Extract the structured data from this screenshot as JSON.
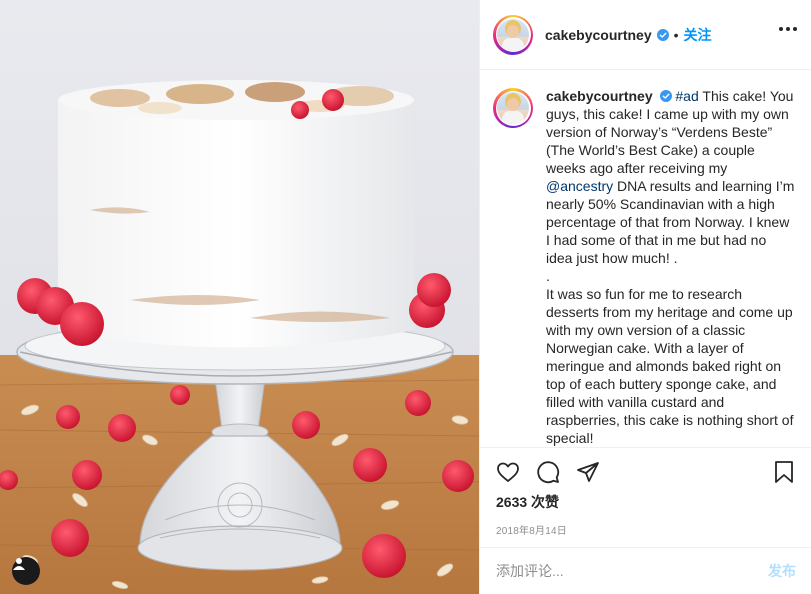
{
  "photo": {
    "subject": "cake-photo",
    "user_tag_icon": "user-icon"
  },
  "header": {
    "username": "cakebycourtney",
    "verified_icon": "verified-badge-icon",
    "separator": "•",
    "follow_label": "关注",
    "more_icon": "more-options-icon"
  },
  "caption": {
    "username": "cakebycourtney",
    "hashtag": "#ad",
    "text_1": " This cake! You guys, this cake! I came up with my own version of Norway’s “Verdens Beste” (The World’s Best Cake) a couple weeks ago after receiving my ",
    "mention": "@ancestry",
    "text_2": " DNA results and learning I’m nearly 50% Scandinavian with a high percentage of that from Norway. I knew I had some of that in me but had no idea just how much! .",
    "dot_line": ".",
    "paragraph_2": "It was so fun for me to research desserts from my heritage and come up with my own version of a classic Norwegian cake. With a layer of meringue and almonds baked right on top of each buttery sponge cake, and filled with vanilla custard and raspberries, this cake is nothing short of special!"
  },
  "actions": {
    "like_icon": "heart-icon",
    "comment_icon": "comment-icon",
    "share_icon": "share-icon",
    "save_icon": "bookmark-icon"
  },
  "likes": "2633 次赞",
  "date": "2018年8月14日",
  "comment": {
    "placeholder": "添加评论...",
    "post_label": "发布"
  },
  "colors": {
    "accent": "#0095f6",
    "link": "#00376b",
    "muted": "#8e8e8e",
    "post_disabled": "#b2dffc"
  }
}
